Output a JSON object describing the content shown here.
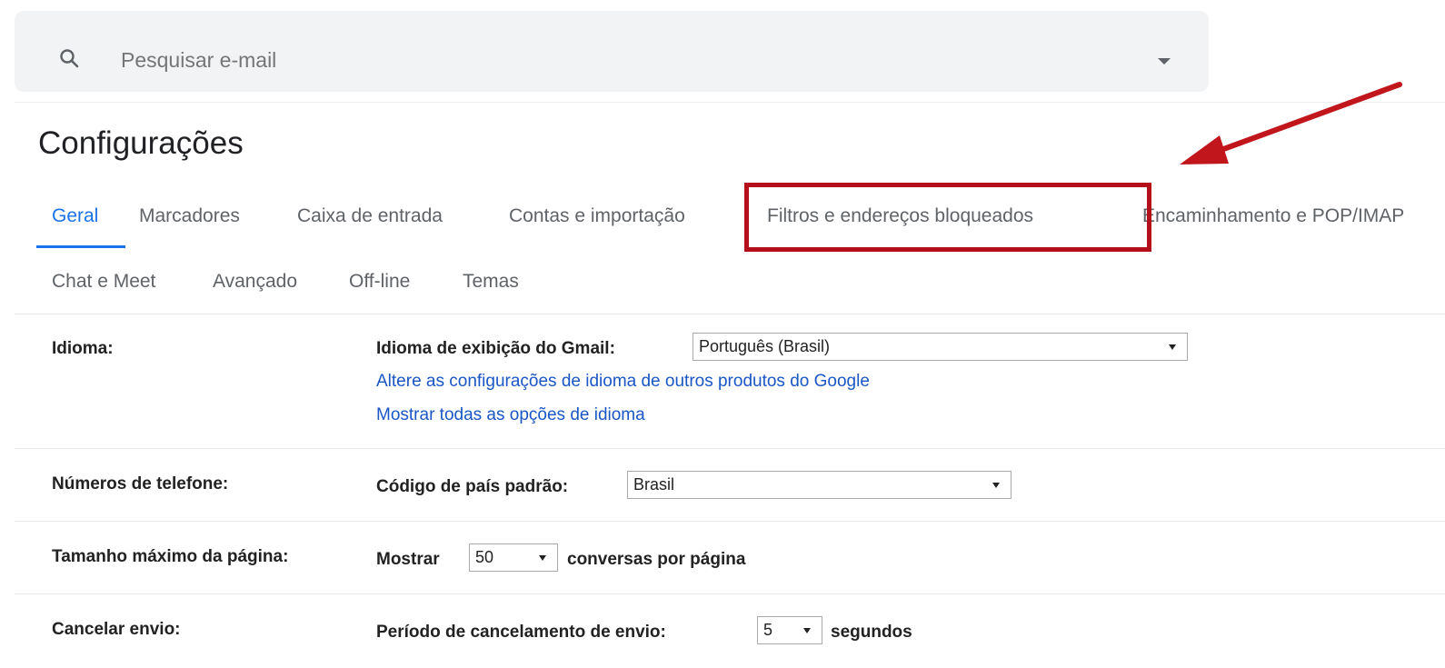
{
  "search": {
    "placeholder": "Pesquisar e-mail",
    "search_icon": "search-icon",
    "options_icon": "caret-down-icon"
  },
  "page": {
    "title": "Configurações"
  },
  "tabs": [
    {
      "label": "Geral",
      "active": true
    },
    {
      "label": "Marcadores"
    },
    {
      "label": "Caixa de entrada"
    },
    {
      "label": "Contas e importação"
    },
    {
      "label": "Filtros e endereços bloqueados",
      "highlighted": true
    },
    {
      "label": "Encaminhamento e POP/IMAP"
    },
    {
      "label": "Chat e Meet"
    },
    {
      "label": "Avançado"
    },
    {
      "label": "Off-line"
    },
    {
      "label": "Temas"
    }
  ],
  "annotation": {
    "highlight_color": "#b41019",
    "arrow_color": "#c0161c"
  },
  "settings": {
    "language": {
      "label": "Idioma:",
      "display_label": "Idioma de exibição do Gmail:",
      "display_value": "Português (Brasil)",
      "link_other_products": "Altere as configurações de idioma de outros produtos do Google",
      "link_all_options": "Mostrar todas as opções de idioma"
    },
    "phone": {
      "label": "Números de telefone:",
      "country_label": "Código de país padrão:",
      "country_value": "Brasil"
    },
    "page_size": {
      "label": "Tamanho máximo da página:",
      "prefix": "Mostrar",
      "value": "50",
      "suffix": "conversas por página"
    },
    "undo_send": {
      "label": "Cancelar envio:",
      "prefix": "Período de cancelamento de envio:",
      "value": "5",
      "suffix": "segundos"
    }
  },
  "colors": {
    "accent": "#1a73e8",
    "link": "#1a56c4"
  }
}
